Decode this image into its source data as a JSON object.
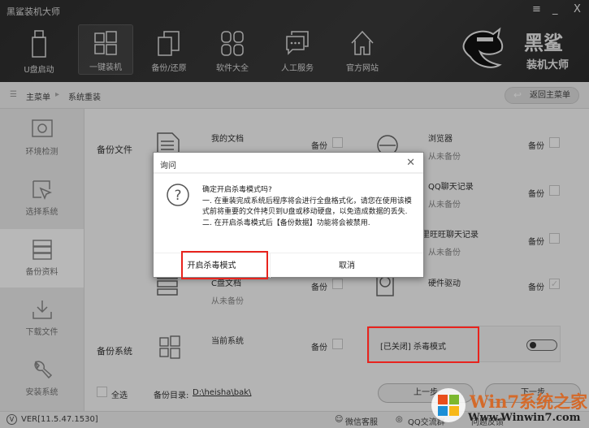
{
  "app": {
    "title": "黑鲨装机大师",
    "menu_icon": "≡",
    "minimize": "_",
    "close": "X"
  },
  "nav": [
    {
      "label": "U盘启动",
      "icon": "usb-icon"
    },
    {
      "label": "一键装机",
      "icon": "windows-icon",
      "active": true
    },
    {
      "label": "备份/还原",
      "icon": "copy-icon"
    },
    {
      "label": "软件大全",
      "icon": "apps-icon"
    },
    {
      "label": "人工服务",
      "icon": "chat-icon"
    },
    {
      "label": "官方网站",
      "icon": "home-icon"
    }
  ],
  "logo": {
    "text1": "黑鲨",
    "text2": "装机大师"
  },
  "breadcrumb": {
    "home": "主菜单",
    "current": "系统重装",
    "back": "返回主菜单"
  },
  "sidebar": [
    {
      "label": "环境检测"
    },
    {
      "label": "选择系统"
    },
    {
      "label": "备份资料",
      "active": true
    },
    {
      "label": "下载文件"
    },
    {
      "label": "安装系统"
    }
  ],
  "backup_files": {
    "section": "备份文件",
    "backup_label": "备份",
    "left": [
      {
        "name": "我的文档",
        "status": ""
      },
      {
        "name": "C盘文档",
        "status": "从未备份"
      }
    ],
    "right": [
      {
        "name": "浏览器",
        "status": "从未备份"
      },
      {
        "name": "QQ聊天记录",
        "status": "从未备份"
      },
      {
        "name": "阿里旺旺聊天记录",
        "status": "从未备份"
      },
      {
        "name": "硬件驱动",
        "status": "",
        "checked": true
      }
    ]
  },
  "backup_system": {
    "section": "备份系统",
    "name": "当前系统",
    "backup_label": "备份",
    "antivirus": "[已关闭] 杀毒模式",
    "antivirus_on": false
  },
  "footer_actions": {
    "select_all": "全选",
    "dir_label": "备份目录:",
    "dir": "D:\\heisha\\bak\\",
    "prev": "上一步",
    "next": "下一步"
  },
  "bottombar": {
    "version": "VER[11.5.47.1530]",
    "wechat": "微信客服",
    "qq": "QQ交流群",
    "feedback": "问题反馈"
  },
  "dialog": {
    "title": "询问",
    "question": "确定开启杀毒模式吗?",
    "line1": "一. 在重装完成系统后程序将会进行全盘格式化，请您在使用该模式前将重要的文件拷贝到U盘或移动硬盘，以免造成数据的丢失.",
    "line2": "二. 在开启杀毒模式后【备份数据】功能将会被禁用.",
    "confirm": "开启杀毒模式",
    "cancel": "取消"
  },
  "watermark": {
    "text": "Win7系统之家",
    "url": "Www.Winwin7.com"
  },
  "colors": {
    "highlight": "#e8231d"
  }
}
